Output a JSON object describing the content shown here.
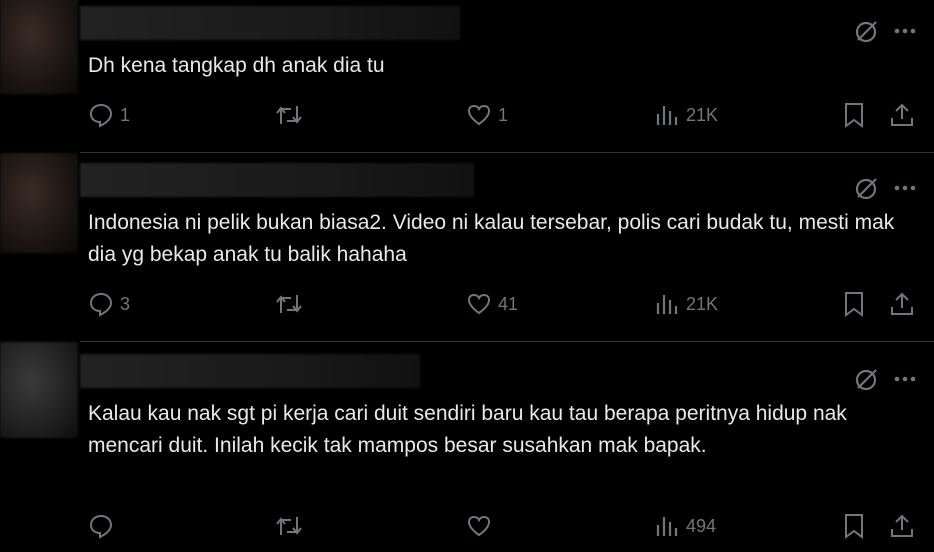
{
  "tweets": [
    {
      "text": "Dh kena tangkap dh anak dia tu",
      "replies": "1",
      "retweets": "",
      "likes": "1",
      "views": "21K"
    },
    {
      "text": "Indonesia ni pelik bukan biasa2. Video ni kalau tersebar, polis cari budak tu, mesti mak dia yg bekap anak tu balik hahaha",
      "replies": "3",
      "retweets": "",
      "likes": "41",
      "views": "21K"
    },
    {
      "text": "Kalau kau nak sgt pi kerja cari duit sendiri baru kau tau berapa peritnya hidup nak mencari duit. Inilah kecik tak mampos besar susahkan mak bapak.",
      "replies": "",
      "retweets": "",
      "likes": "",
      "views": "494"
    }
  ],
  "icons": {
    "grok": "grok-icon",
    "more": "more-icon",
    "reply": "reply-icon",
    "retweet": "retweet-icon",
    "like": "like-icon",
    "views": "views-icon",
    "bookmark": "bookmark-icon",
    "share": "share-icon"
  },
  "colors": {
    "background": "#000000",
    "text": "#e7e9ea",
    "muted": "#71767b",
    "divider": "#2f3336"
  }
}
